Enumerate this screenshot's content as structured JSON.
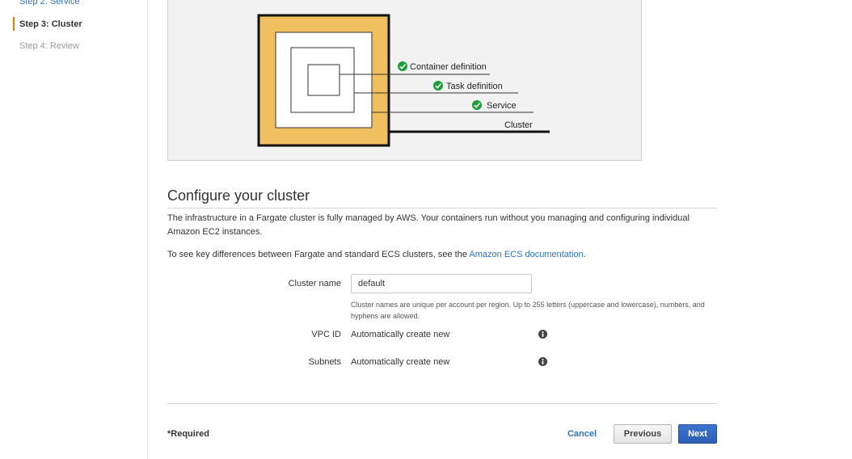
{
  "sidebar": {
    "steps": [
      {
        "label": "Step 2: Service",
        "state": "link"
      },
      {
        "label": "Step 3: Cluster",
        "state": "current"
      },
      {
        "label": "Step 4: Review",
        "state": "disabled"
      }
    ],
    "active_marker_color": "#e07b00"
  },
  "diagram": {
    "labels": {
      "container": "Container definition",
      "task": "Task definition",
      "service": "Service",
      "cluster": "Cluster"
    },
    "colors": {
      "cluster_fill": "#f0c060",
      "check": "#1e9e3a"
    },
    "icon": "check-circle-icon"
  },
  "config": {
    "heading": "Configure your cluster",
    "description_1": "The infrastructure in a Fargate cluster is fully managed by AWS. Your containers run without you managing and configuring individual Amazon EC2 instances.",
    "description_2_prefix": "To see key differences between Fargate and standard ECS clusters, see the ",
    "description_2_link": "Amazon ECS documentation",
    "description_2_suffix": ".",
    "cluster_name_label": "Cluster name",
    "cluster_name_value": "default",
    "cluster_name_help": "Cluster names are unique per account per region. Up to 255 letters (uppercase and lowercase), numbers, and hyphens are allowed.",
    "vpc_label": "VPC ID",
    "vpc_value": "Automatically create new",
    "subnets_label": "Subnets",
    "subnets_value": "Automatically create new",
    "info_icon": "info-icon"
  },
  "footer": {
    "required": "*Required",
    "cancel": "Cancel",
    "previous": "Previous",
    "next": "Next"
  }
}
